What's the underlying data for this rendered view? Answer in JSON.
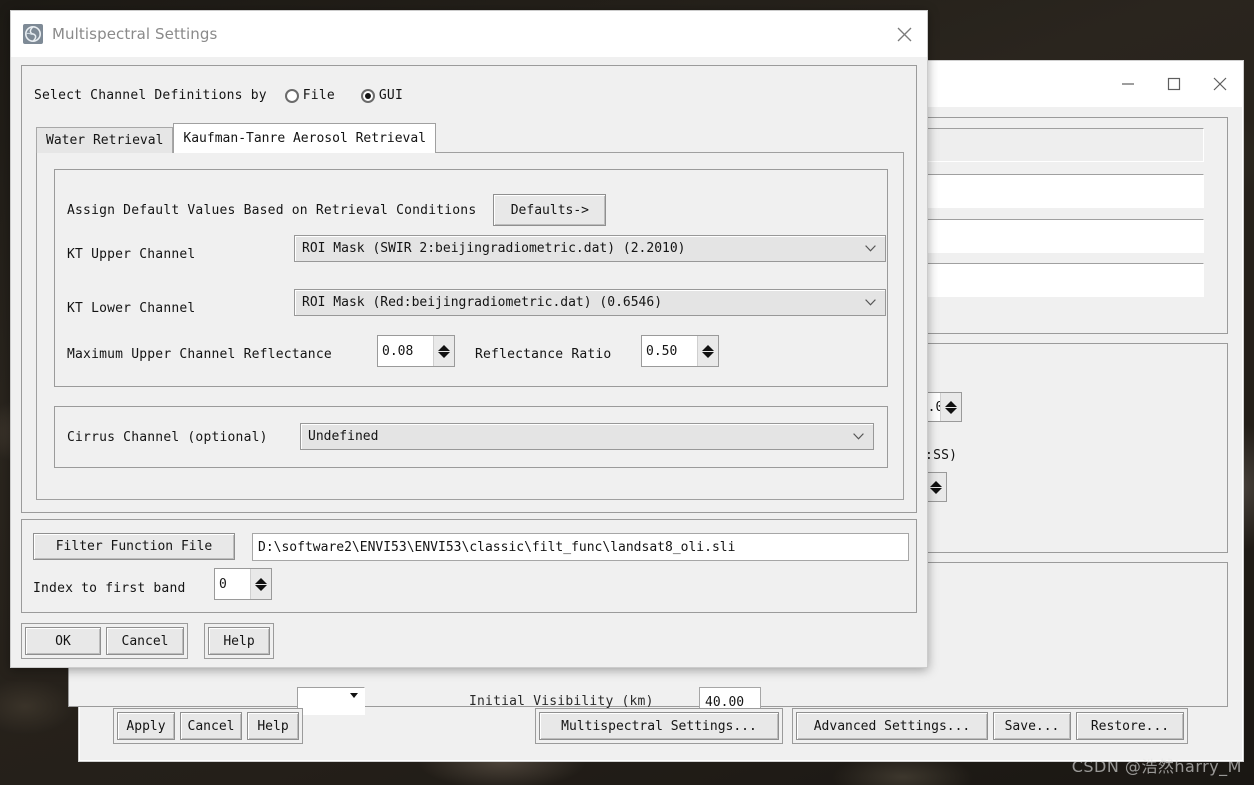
{
  "background_window": {
    "title": "",
    "titlebar_buttons": [
      {
        "name": "minimize",
        "glyph": "minimize-icon"
      },
      {
        "name": "maximize",
        "glyph": "maximize-icon"
      },
      {
        "name": "close",
        "glyph": "close-icon"
      }
    ],
    "partial_row": {
      "visibility_label": "Initial Visibility (km)",
      "visibility_value": "40.00",
      "time_format_hint": "MM:SS)"
    },
    "footer": {
      "left_buttons": [
        "Apply",
        "Cancel",
        "Help"
      ],
      "right_buttons": [
        "Multispectral Settings...",
        "Advanced Settings...",
        "Save...",
        "Restore..."
      ]
    }
  },
  "dialog": {
    "title": "Multispectral Settings",
    "icon": "envi-globe-icon",
    "close_label": "close-icon",
    "channel_definitions": {
      "label": "Select Channel Definitions by",
      "options": [
        {
          "label": "File",
          "selected": false
        },
        {
          "label": "GUI",
          "selected": true
        }
      ]
    },
    "tabs": [
      {
        "label": "Water Retrieval",
        "active": false
      },
      {
        "label": "Kaufman-Tanre Aerosol Retrieval",
        "active": true
      }
    ],
    "retrieval_panel": {
      "defaults_label": "Assign Default Values Based on Retrieval Conditions",
      "defaults_button": "Defaults->",
      "kt_upper_label": "KT Upper Channel",
      "kt_upper_value": "ROI Mask (SWIR 2:beijingradiometric.dat) (2.2010)",
      "kt_lower_label": "KT Lower Channel",
      "kt_lower_value": "ROI Mask (Red:beijingradiometric.dat) (0.6546)",
      "max_reflectance_label": "Maximum Upper Channel Reflectance",
      "max_reflectance_value": "0.08",
      "ratio_label": "Reflectance Ratio",
      "ratio_value": "0.50"
    },
    "cirrus": {
      "label": "Cirrus Channel (optional)",
      "value": "Undefined"
    },
    "filter_function": {
      "button_label": "Filter Function File",
      "path": "D:\\software2\\ENVI53\\ENVI53\\classic\\filt_func\\landsat8_oli.sli",
      "index_label": "Index to first band",
      "index_value": "0"
    },
    "footer_buttons": [
      {
        "label": "OK"
      },
      {
        "label": "Cancel"
      },
      {
        "label": "Help"
      }
    ]
  },
  "watermark": "CSDN @浩然harry_M",
  "colors": {
    "dialog_face": "#f0f0f0",
    "titlebar": "#ffffff",
    "title_text": "#8a8a8a",
    "field_text": "#141414",
    "combo_face": "#e4e4e4",
    "desktop": "#221d17"
  }
}
